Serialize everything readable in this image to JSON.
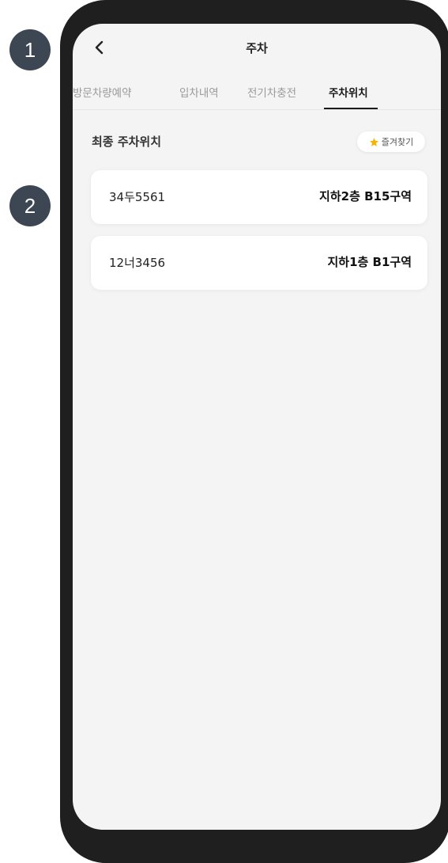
{
  "badges": [
    "1",
    "2"
  ],
  "header": {
    "title": "주차",
    "back_icon": "chevron-left-icon"
  },
  "tabs": [
    {
      "label": "방문차량예약",
      "active": false
    },
    {
      "label": "입차내역",
      "active": false
    },
    {
      "label": "전기차충전",
      "active": false
    },
    {
      "label": "주차위치",
      "active": true
    }
  ],
  "section": {
    "title": "최종 주차위치",
    "favorite_label": "즐겨찾기",
    "favorite_icon": "star-icon"
  },
  "parking": [
    {
      "plate": "34두5561",
      "location": "지하2층 B15구역"
    },
    {
      "plate": "12너3456",
      "location": "지하1층 B1구역"
    }
  ],
  "colors": {
    "accent_star": "#f5b400",
    "screen_bg": "#f4f4f4",
    "badge_bg": "#3d4754"
  }
}
